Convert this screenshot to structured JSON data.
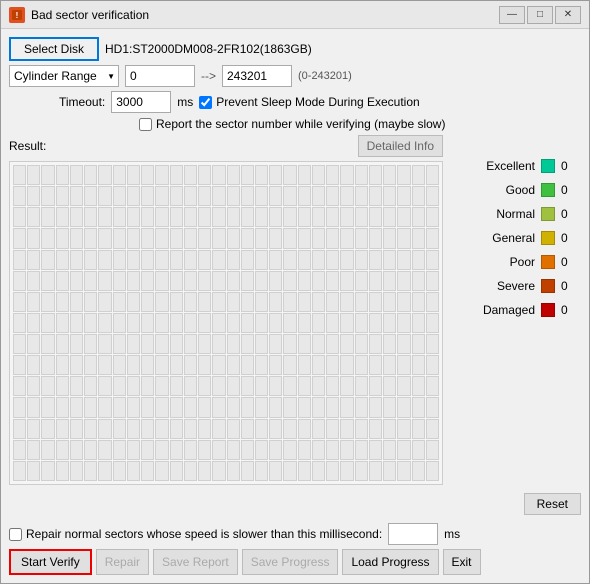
{
  "window": {
    "title": "Bad sector verification",
    "icon_label": "B"
  },
  "title_controls": {
    "minimize": "—",
    "maximize": "□",
    "close": "✕"
  },
  "select_disk": {
    "label": "Select Disk",
    "disk_info": "HD1:ST2000DM008-2FR102(1863GB)"
  },
  "cylinder_range": {
    "dropdown_value": "Cylinder Range",
    "start": "0",
    "end": "243201",
    "hint": "(0-243201)"
  },
  "timeout": {
    "label": "Timeout:",
    "value": "3000",
    "unit": "ms"
  },
  "checkboxes": {
    "prevent_sleep": {
      "label": "Prevent Sleep Mode During Execution",
      "checked": true
    },
    "report_sector": {
      "label": "Report the sector number while verifying (maybe slow)",
      "checked": false
    }
  },
  "result": {
    "label": "Result:",
    "detailed_btn": "Detailed Info"
  },
  "legend": [
    {
      "name": "Excellent",
      "color": "#00c896",
      "count": "0"
    },
    {
      "name": "Good",
      "color": "#40c040",
      "count": "0"
    },
    {
      "name": "Normal",
      "color": "#a0c040",
      "count": "0"
    },
    {
      "name": "General",
      "color": "#d0b000",
      "count": "0"
    },
    {
      "name": "Poor",
      "color": "#e07000",
      "count": "0"
    },
    {
      "name": "Severe",
      "color": "#c04000",
      "count": "0"
    },
    {
      "name": "Damaged",
      "color": "#c00000",
      "count": "0"
    }
  ],
  "reset_btn": "Reset",
  "repair_row": {
    "label": "Repair normal sectors whose speed is slower than this millisecond:",
    "value": "",
    "unit": "ms"
  },
  "buttons": {
    "start_verify": "Start Verify",
    "repair": "Repair",
    "save_report": "Save Report",
    "save_progress": "Save Progress",
    "load_progress": "Load Progress",
    "exit": "Exit"
  }
}
